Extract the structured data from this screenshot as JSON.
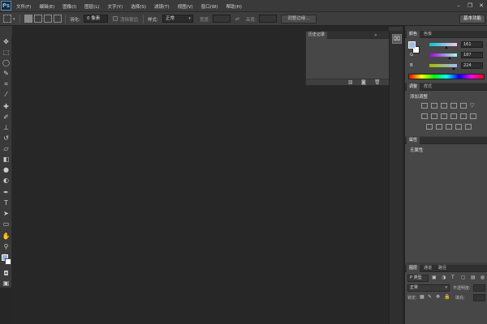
{
  "app": {
    "logo": "Ps"
  },
  "menu": [
    "文件(F)",
    "编辑(E)",
    "图像(I)",
    "图层(L)",
    "文字(Y)",
    "选择(S)",
    "滤镜(T)",
    "视图(V)",
    "窗口(W)",
    "帮助(H)"
  ],
  "window_controls": {
    "minimize": "–",
    "restore": "❐",
    "close": "✕"
  },
  "options": {
    "feather_label": "羽化:",
    "feather_value": "0 像素",
    "antialias_label": "消除锯齿",
    "style_label": "样式:",
    "style_value": "正常",
    "width_label": "宽度:",
    "height_label": "高度:",
    "refine_button": "调整边缘...",
    "workspace_button": "基本功能"
  },
  "history_panel": {
    "tab": "历史记录",
    "collapse": "»",
    "menu": "≡"
  },
  "color_panel": {
    "tabs": [
      "颜色",
      "色板"
    ],
    "channels": [
      {
        "label": "R",
        "value": "161",
        "gradient": "linear-gradient(to right,#00c4e0,#ffc4e0)",
        "pos": 0.63
      },
      {
        "label": "G",
        "value": "187",
        "gradient": "linear-gradient(to right,#a100e0,#a1ffe0)",
        "pos": 0.73
      },
      {
        "label": "B",
        "value": "224",
        "gradient": "linear-gradient(to right,#a1bb00,#a1bbff)",
        "pos": 0.88
      }
    ],
    "fg_color": "#a1bbe0"
  },
  "adjustments_panel": {
    "tabs": [
      "调整",
      "样式"
    ],
    "title": "添加调整"
  },
  "properties_panel": {
    "tab": "属性",
    "text": "无属性"
  },
  "layers_panel": {
    "tabs": [
      "图层",
      "通道",
      "路径"
    ],
    "kind_value": "P 类型",
    "mode_value": "正常",
    "opacity_label": "不透明度:",
    "lock_label": "锁定:",
    "fill_label": "填充:"
  }
}
